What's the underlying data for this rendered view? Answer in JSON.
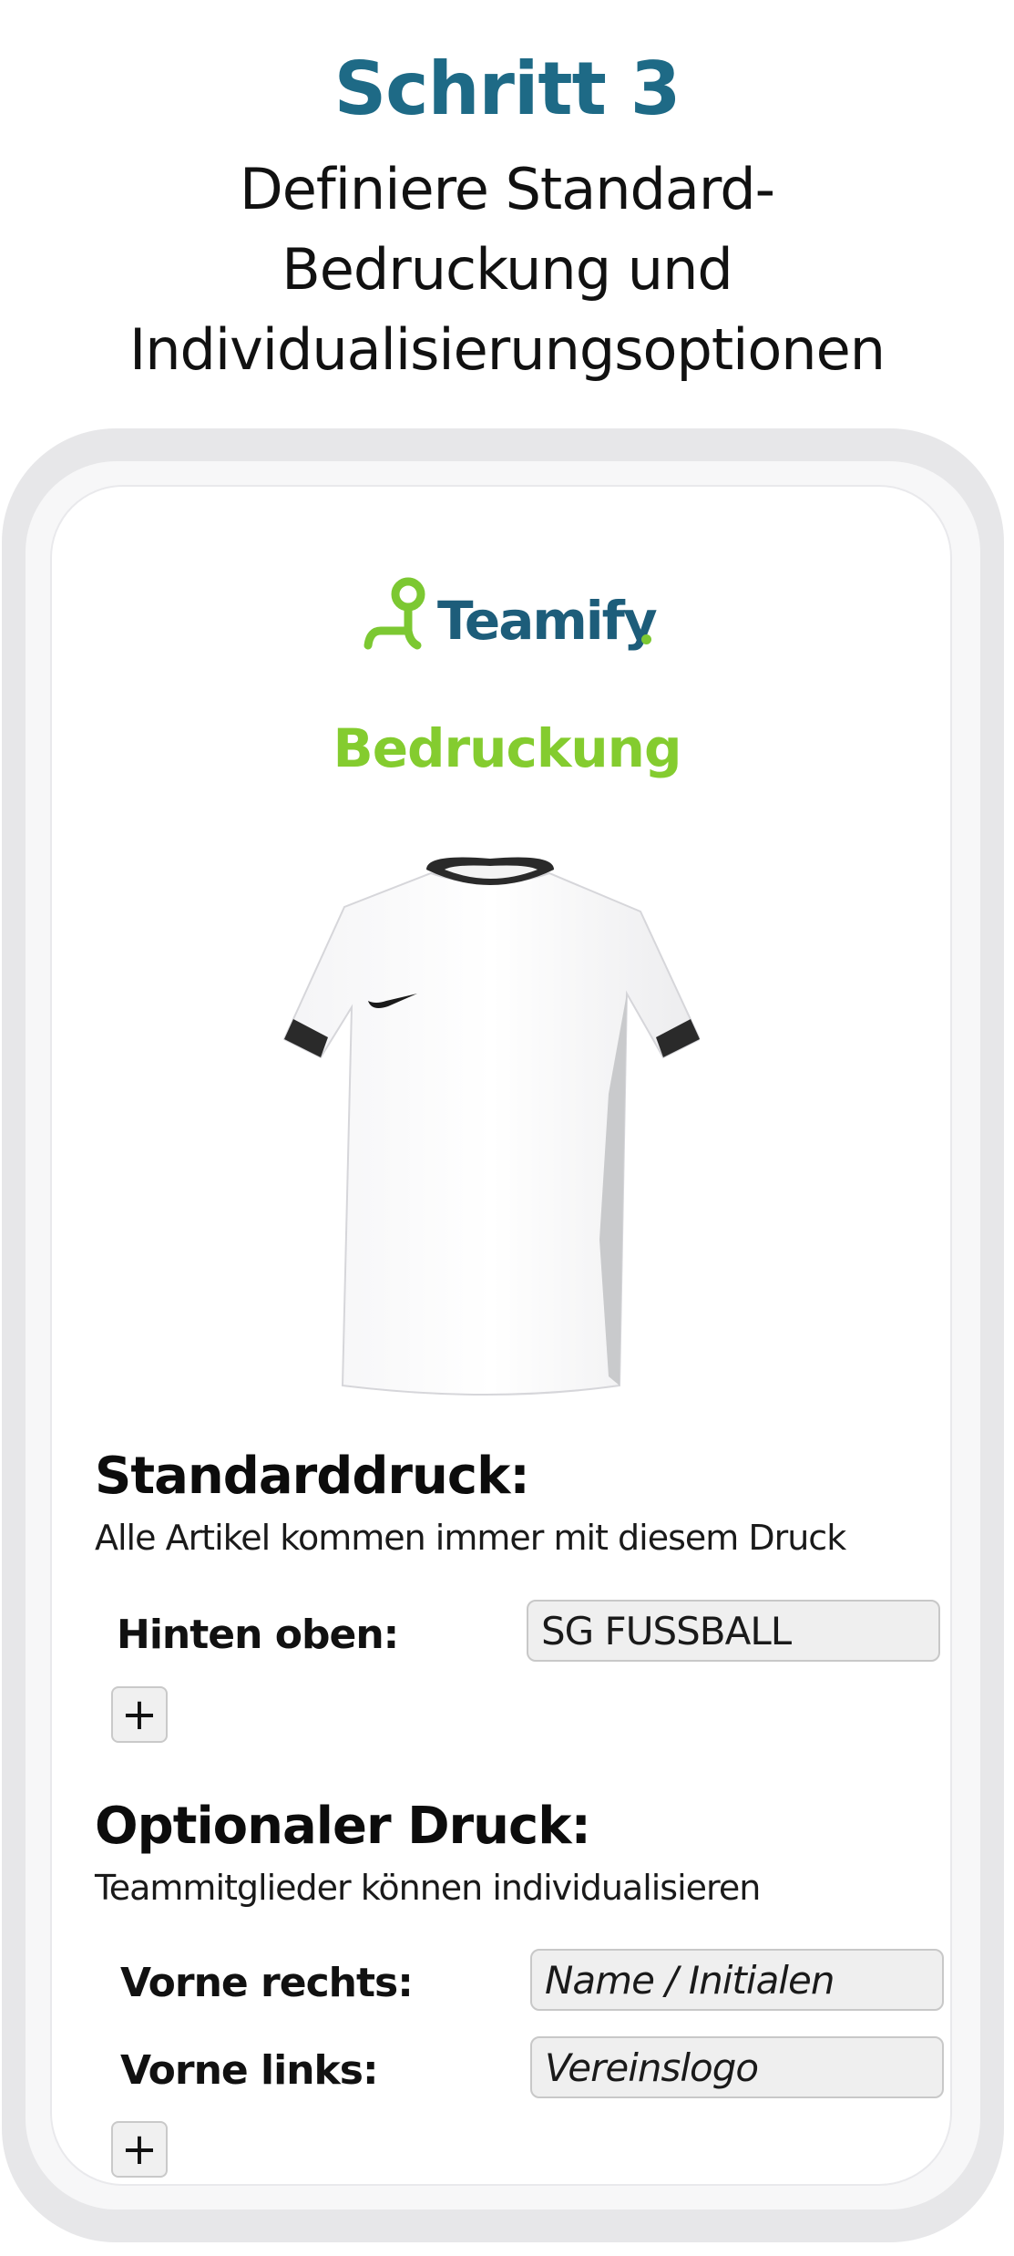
{
  "header": {
    "step": "Schritt 3",
    "subtitle_lines": [
      "Definiere Standard-",
      "Bedruckung und",
      "Individualisierungsoptionen"
    ]
  },
  "brand": {
    "name": "Teamify",
    "dot": ".",
    "primary_color": "#1d5d7a",
    "accent_color": "#7cc832",
    "icon": "teamify-logo-icon"
  },
  "screen": {
    "title": "Bedruckung",
    "product_image": "white-shirt-with-black-collar"
  },
  "standard_print": {
    "title": "Standarddruck:",
    "description": "Alle Artikel kommen immer mit diesem Druck",
    "rows": [
      {
        "label": "Hinten oben:",
        "value": "SG FUSSBALL"
      }
    ],
    "add_label": "+"
  },
  "optional_print": {
    "title": "Optionaler Druck:",
    "description": "Teammitglieder können individualisieren",
    "rows": [
      {
        "label": "Vorne rechts:",
        "value": "Name / Initialen"
      },
      {
        "label": "Vorne links:",
        "value": "Vereinslogo"
      }
    ],
    "add_label": "+"
  }
}
